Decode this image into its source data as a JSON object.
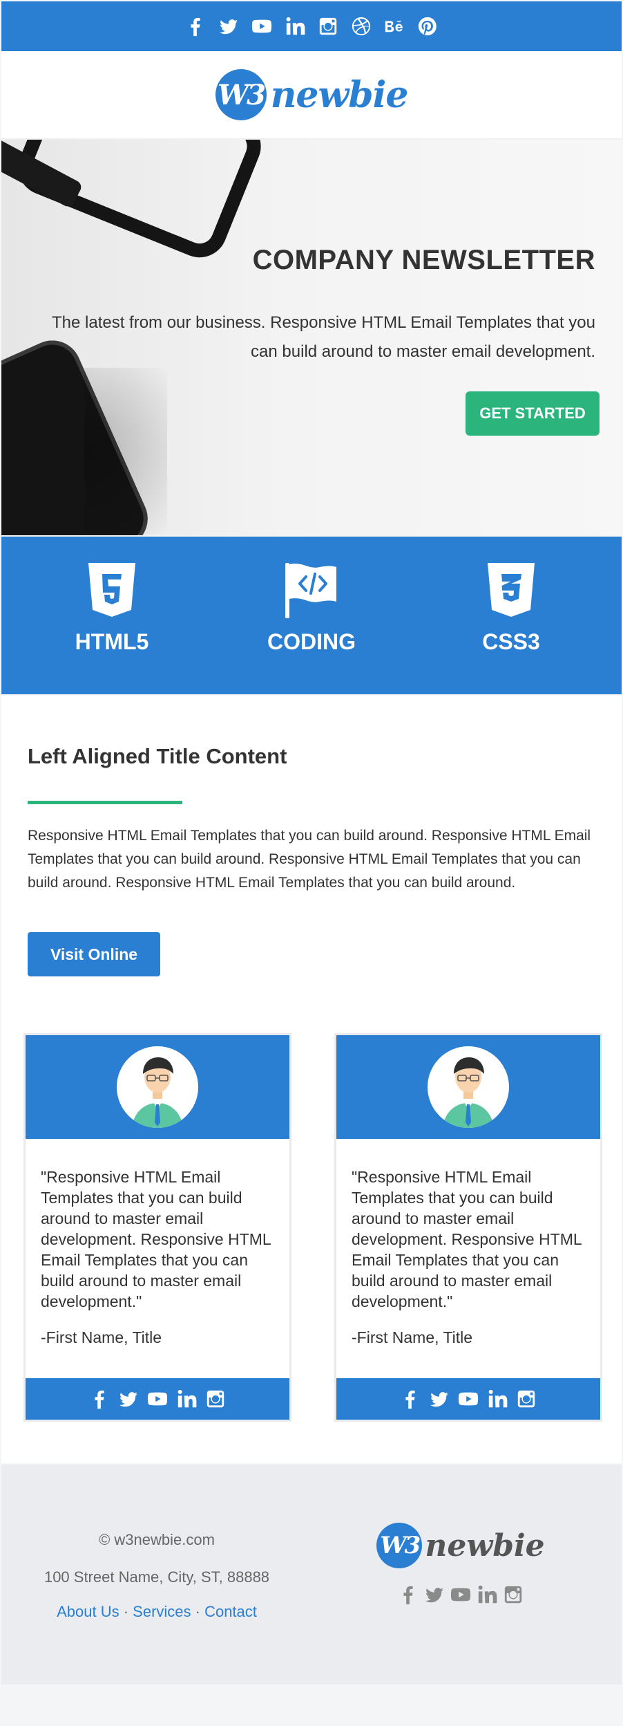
{
  "colors": {
    "brand_blue": "#2a7fd3",
    "accent_green": "#2bb57c",
    "footer_bg": "#eaecef"
  },
  "social_top": [
    "facebook-icon",
    "twitter-icon",
    "youtube-icon",
    "linkedin-icon",
    "instagram-icon",
    "dribbble-icon",
    "behance-icon",
    "pinterest-icon"
  ],
  "logo": {
    "mark": "W3",
    "word": "newbie"
  },
  "hero": {
    "title": "COMPANY NEWSLETTER",
    "subtitle": "The latest from our business. Responsive HTML Email Templates that you can build around to master email development.",
    "cta": "GET STARTED"
  },
  "features": [
    {
      "icon": "html5-icon",
      "label": "HTML5"
    },
    {
      "icon": "code-flag-icon",
      "label": "CODING"
    },
    {
      "icon": "css3-icon",
      "label": "CSS3"
    }
  ],
  "content": {
    "title": "Left Aligned Title Content",
    "body": "Responsive HTML Email Templates that you can build around. Responsive HTML Email Templates that you can build around. Responsive HTML Email Templates that you can build around. Responsive HTML Email Templates that you can build around.",
    "button": "Visit Online"
  },
  "testimonials": [
    {
      "quote": "\"Responsive HTML Email Templates that you can build around to master email development. Responsive HTML Email Templates that you can build around to master email development.\"",
      "signature": "-First Name, Title"
    },
    {
      "quote": "\"Responsive HTML Email Templates that you can build around to master email development. Responsive HTML Email Templates that you can build around to master email development.\"",
      "signature": "-First Name, Title"
    }
  ],
  "footer": {
    "copyright": "© w3newbie.com",
    "address": "100 Street Name, City, ST, 88888",
    "links": [
      "About Us",
      "Services",
      "Contact"
    ],
    "separator": " · "
  }
}
